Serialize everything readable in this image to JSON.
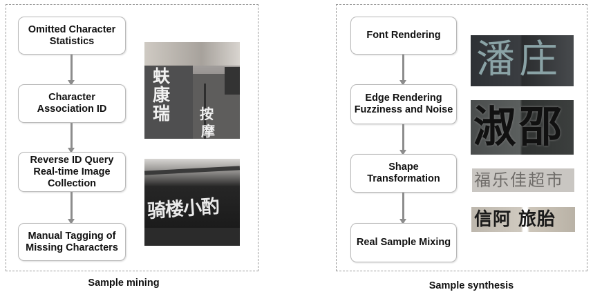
{
  "mining": {
    "caption": "Sample mining",
    "steps": [
      "Omitted Character\nStatistics",
      "Character\nAssociation ID",
      "Reverse ID Query\nReal-time Image\nCollection",
      "Manual Tagging of\nMissing Characters"
    ],
    "photo1_chars": [
      "蚨",
      "康",
      "瑞",
      "按",
      "摩"
    ],
    "photo2_chars": "骑楼小酌"
  },
  "synthesis": {
    "caption": "Sample synthesis",
    "steps": [
      "Font Rendering",
      "Edge Rendering\nFuzziness and Noise",
      "Shape\nTransformation",
      "Real Sample Mixing"
    ],
    "sample1_chars": "潘庄",
    "sample2_chars": "淑邵",
    "sample3_chars": "福乐佳超市",
    "sample4_chars": "信阿 旅胎"
  }
}
